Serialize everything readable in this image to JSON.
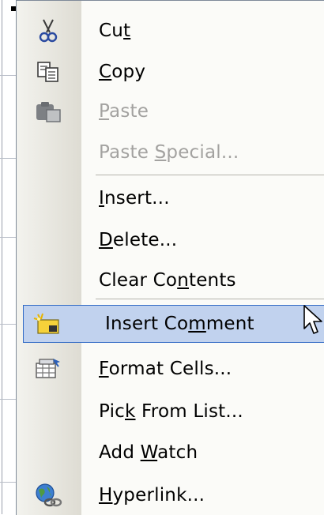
{
  "menu": {
    "items": [
      {
        "id": "cut",
        "pre": "Cu",
        "u": "t",
        "post": "",
        "icon": "scissors-icon",
        "disabled": false
      },
      {
        "id": "copy",
        "pre": "",
        "u": "C",
        "post": "opy",
        "icon": "copy-icon",
        "disabled": false
      },
      {
        "id": "paste",
        "pre": "",
        "u": "P",
        "post": "aste",
        "icon": "paste-icon",
        "disabled": true
      },
      {
        "id": "paste-special",
        "pre": "Paste ",
        "u": "S",
        "post": "pecial...",
        "icon": "",
        "disabled": true
      },
      {
        "id": "insert",
        "pre": "",
        "u": "I",
        "post": "nsert...",
        "icon": "",
        "disabled": false
      },
      {
        "id": "delete",
        "pre": "",
        "u": "D",
        "post": "elete...",
        "icon": "",
        "disabled": false
      },
      {
        "id": "clear-contents",
        "pre": "Clear Co",
        "u": "n",
        "post": "tents",
        "icon": "",
        "disabled": false
      },
      {
        "id": "insert-comment",
        "pre": "Insert Co",
        "u": "m",
        "post": "ment",
        "icon": "insert-comment-icon",
        "disabled": false,
        "highlighted": true
      },
      {
        "id": "format-cells",
        "pre": "",
        "u": "F",
        "post": "ormat Cells...",
        "icon": "format-cells-icon",
        "disabled": false
      },
      {
        "id": "pick-from-list",
        "pre": "Pic",
        "u": "k",
        "post": " From List...",
        "icon": "",
        "disabled": false
      },
      {
        "id": "add-watch",
        "pre": "Add ",
        "u": "W",
        "post": "atch",
        "icon": "",
        "disabled": false
      },
      {
        "id": "hyperlink",
        "pre": "",
        "u": "H",
        "post": "yperlink...",
        "icon": "hyperlink-icon",
        "disabled": false
      }
    ]
  }
}
